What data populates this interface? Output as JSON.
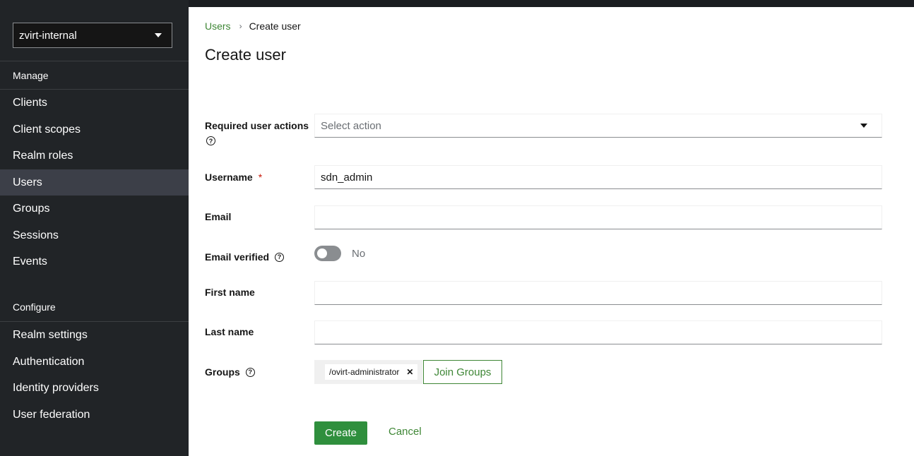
{
  "realm": {
    "selected": "zvirt-internal"
  },
  "sidebar": {
    "manage_title": "Manage",
    "manage_items": [
      {
        "label": "Clients"
      },
      {
        "label": "Client scopes"
      },
      {
        "label": "Realm roles"
      },
      {
        "label": "Users",
        "active": true
      },
      {
        "label": "Groups"
      },
      {
        "label": "Sessions"
      },
      {
        "label": "Events"
      }
    ],
    "configure_title": "Configure",
    "configure_items": [
      {
        "label": "Realm settings"
      },
      {
        "label": "Authentication"
      },
      {
        "label": "Identity providers"
      },
      {
        "label": "User federation"
      }
    ]
  },
  "breadcrumb": {
    "parent": "Users",
    "separator": "›",
    "current": "Create user"
  },
  "page": {
    "title": "Create user"
  },
  "form": {
    "required_actions": {
      "label": "Required user actions",
      "placeholder": "Select action"
    },
    "username": {
      "label": "Username",
      "required_mark": "*",
      "value": "sdn_admin"
    },
    "email": {
      "label": "Email",
      "value": ""
    },
    "email_verified": {
      "label": "Email verified",
      "state_text": "No",
      "on": false
    },
    "first_name": {
      "label": "First name",
      "value": ""
    },
    "last_name": {
      "label": "Last name",
      "value": ""
    },
    "groups": {
      "label": "Groups",
      "chips": [
        "/ovirt-administrator"
      ],
      "join_label": "Join Groups"
    }
  },
  "actions": {
    "create_label": "Create",
    "cancel_label": "Cancel"
  },
  "colors": {
    "accent": "#3e8635",
    "primary_button": "#2f8f3d",
    "sidebar_bg": "#212427",
    "active_nav": "#3c3f48",
    "required": "#c9190b"
  }
}
